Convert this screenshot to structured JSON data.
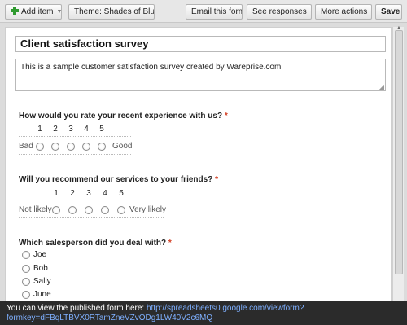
{
  "toolbar": {
    "add_item": "Add item",
    "theme": "Theme:  Shades of Blue",
    "email_form": "Email this form",
    "see_responses": "See responses",
    "more_actions": "More actions",
    "save": "Save"
  },
  "form": {
    "title": "Client satisfaction survey",
    "description": "This is a sample customer satisfaction survey created by Wareprise.com",
    "required_mark": "*",
    "q1": {
      "text": "How would you rate your recent experience with us?",
      "scale": [
        "1",
        "2",
        "3",
        "4",
        "5"
      ],
      "low_label": "Bad",
      "high_label": "Good"
    },
    "q2": {
      "text": "Will you recommend our services to your friends?",
      "scale": [
        "1",
        "2",
        "3",
        "4",
        "5"
      ],
      "low_label": "Not likely",
      "high_label": "Very likely"
    },
    "q3": {
      "text": "Which salesperson did you deal with?",
      "options": [
        "Joe",
        "Bob",
        "Sally",
        "June"
      ]
    }
  },
  "notice": {
    "text": "You can view the published form here:",
    "link_line1": "http://spreadsheets0.google.com/viewform?",
    "link_line2": "formkey=dFBqLTBVX0RTamZneVZvODg1LW40V2c6MQ"
  },
  "colors": {
    "required": "#d23a1e",
    "link": "#7fb0ff",
    "add_icon": "#2f9a2f"
  }
}
